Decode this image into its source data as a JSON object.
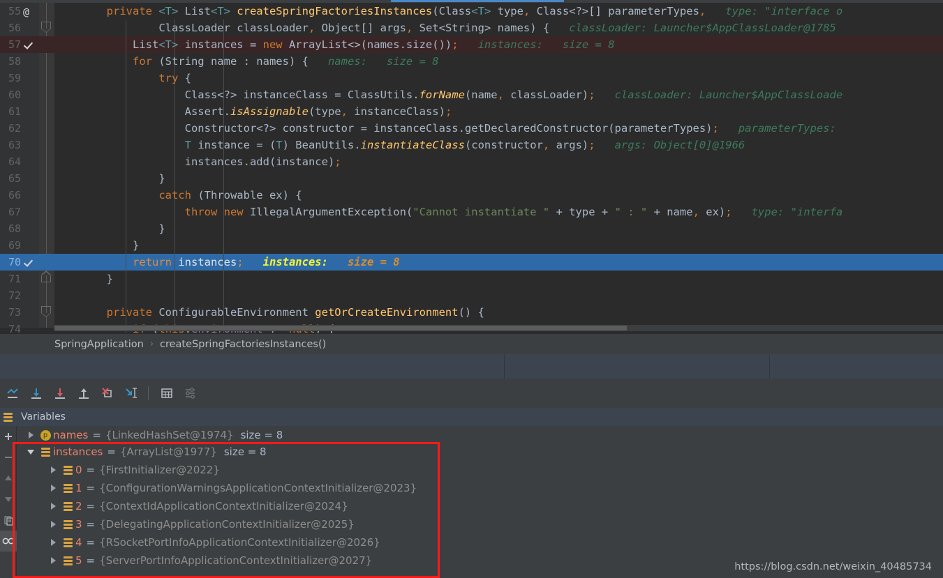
{
  "editor": {
    "active_tab_accent": "#4a88c7",
    "lines": [
      {
        "num": "55",
        "gutter": "annotation",
        "fold": "none",
        "highlight": "none",
        "segments": [
          {
            "t": "        ",
            "c": "id"
          },
          {
            "t": "private ",
            "c": "kw"
          },
          {
            "t": "<T> ",
            "c": "tp"
          },
          {
            "t": "List",
            "c": "id"
          },
          {
            "t": "<T> ",
            "c": "tp"
          },
          {
            "t": "createSpringFactoriesInstances",
            "c": "fn"
          },
          {
            "t": "(",
            "c": "punc"
          },
          {
            "t": "Class",
            "c": "id"
          },
          {
            "t": "<T> ",
            "c": "tp"
          },
          {
            "t": "type",
            "c": "id"
          },
          {
            "t": ", ",
            "c": "semi"
          },
          {
            "t": "Class<?>[] ",
            "c": "id"
          },
          {
            "t": "parameterTypes",
            "c": "id"
          },
          {
            "t": ",",
            "c": "semi"
          },
          {
            "t": "   type: \"interface o",
            "c": "hint"
          }
        ]
      },
      {
        "num": "56",
        "gutter": "none",
        "fold": "down",
        "highlight": "none",
        "segments": [
          {
            "t": "                ",
            "c": "id"
          },
          {
            "t": "ClassLoader classLoader",
            "c": "id"
          },
          {
            "t": ", ",
            "c": "semi"
          },
          {
            "t": "Object[] args",
            "c": "id"
          },
          {
            "t": ", ",
            "c": "semi"
          },
          {
            "t": "Set<String> names",
            "c": "id"
          },
          {
            "t": ") {",
            "c": "punc"
          },
          {
            "t": "   classLoader: Launcher$AppClassLoader@1785",
            "c": "hint"
          }
        ]
      },
      {
        "num": "57",
        "gutter": "breakpoint",
        "fold": "none",
        "highlight": "bp",
        "segments": [
          {
            "t": "            ",
            "c": "id"
          },
          {
            "t": "List",
            "c": "id"
          },
          {
            "t": "<T> ",
            "c": "tp"
          },
          {
            "t": "instances = ",
            "c": "id"
          },
          {
            "t": "new ",
            "c": "kw"
          },
          {
            "t": "ArrayList<>(names.size())",
            "c": "id"
          },
          {
            "t": ";",
            "c": "semi"
          },
          {
            "t": "   instances:   size = 8",
            "c": "hint"
          }
        ]
      },
      {
        "num": "58",
        "gutter": "none",
        "fold": "none",
        "highlight": "none",
        "segments": [
          {
            "t": "            ",
            "c": "id"
          },
          {
            "t": "for ",
            "c": "kw"
          },
          {
            "t": "(String name : names) {",
            "c": "id"
          },
          {
            "t": "   names:   size = 8",
            "c": "hint"
          }
        ]
      },
      {
        "num": "59",
        "gutter": "none",
        "fold": "none",
        "highlight": "none",
        "segments": [
          {
            "t": "                ",
            "c": "id"
          },
          {
            "t": "try ",
            "c": "kw"
          },
          {
            "t": "{",
            "c": "punc"
          }
        ]
      },
      {
        "num": "60",
        "gutter": "none",
        "fold": "none",
        "highlight": "none",
        "segments": [
          {
            "t": "                    ",
            "c": "id"
          },
          {
            "t": "Class<?> instanceClass = ClassUtils.",
            "c": "id"
          },
          {
            "t": "forName",
            "c": "fni"
          },
          {
            "t": "(name",
            "c": "id"
          },
          {
            "t": ", ",
            "c": "semi"
          },
          {
            "t": "classLoader)",
            "c": "id"
          },
          {
            "t": ";",
            "c": "semi"
          },
          {
            "t": "   classLoader: Launcher$AppClassLoade",
            "c": "hint"
          }
        ]
      },
      {
        "num": "61",
        "gutter": "none",
        "fold": "none",
        "highlight": "none",
        "segments": [
          {
            "t": "                    ",
            "c": "id"
          },
          {
            "t": "Assert.",
            "c": "id"
          },
          {
            "t": "isAssignable",
            "c": "fni"
          },
          {
            "t": "(type",
            "c": "id"
          },
          {
            "t": ", ",
            "c": "semi"
          },
          {
            "t": "instanceClass)",
            "c": "id"
          },
          {
            "t": ";",
            "c": "semi"
          }
        ]
      },
      {
        "num": "62",
        "gutter": "none",
        "fold": "none",
        "highlight": "none",
        "segments": [
          {
            "t": "                    ",
            "c": "id"
          },
          {
            "t": "Constructor<?> constructor = instanceClass.getDeclaredConstructor(parameterTypes)",
            "c": "id"
          },
          {
            "t": ";",
            "c": "semi"
          },
          {
            "t": "   parameterTypes:  ",
            "c": "hint"
          }
        ]
      },
      {
        "num": "63",
        "gutter": "none",
        "fold": "none",
        "highlight": "none",
        "segments": [
          {
            "t": "                    ",
            "c": "id"
          },
          {
            "t": "T ",
            "c": "tp"
          },
          {
            "t": "instance = (",
            "c": "id"
          },
          {
            "t": "T",
            "c": "tp"
          },
          {
            "t": ") BeanUtils.",
            "c": "id"
          },
          {
            "t": "instantiateClass",
            "c": "fni"
          },
          {
            "t": "(constructor",
            "c": "id"
          },
          {
            "t": ", ",
            "c": "semi"
          },
          {
            "t": "args)",
            "c": "id"
          },
          {
            "t": ";",
            "c": "semi"
          },
          {
            "t": "   args: Object[0]@1966",
            "c": "hint"
          }
        ]
      },
      {
        "num": "64",
        "gutter": "none",
        "fold": "none",
        "highlight": "none",
        "segments": [
          {
            "t": "                    ",
            "c": "id"
          },
          {
            "t": "instances.add(instance)",
            "c": "id"
          },
          {
            "t": ";",
            "c": "semi"
          }
        ]
      },
      {
        "num": "65",
        "gutter": "none",
        "fold": "none",
        "highlight": "none",
        "segments": [
          {
            "t": "                ",
            "c": "id"
          },
          {
            "t": "}",
            "c": "punc"
          }
        ]
      },
      {
        "num": "66",
        "gutter": "none",
        "fold": "none",
        "highlight": "none",
        "segments": [
          {
            "t": "                ",
            "c": "id"
          },
          {
            "t": "catch ",
            "c": "kw"
          },
          {
            "t": "(Throwable ex) {",
            "c": "id"
          }
        ]
      },
      {
        "num": "67",
        "gutter": "none",
        "fold": "none",
        "highlight": "none",
        "segments": [
          {
            "t": "                    ",
            "c": "id"
          },
          {
            "t": "throw new ",
            "c": "kw"
          },
          {
            "t": "IllegalArgumentException(",
            "c": "id"
          },
          {
            "t": "\"Cannot instantiate \"",
            "c": "str"
          },
          {
            "t": " + type + ",
            "c": "id"
          },
          {
            "t": "\" : \"",
            "c": "str"
          },
          {
            "t": " + name",
            "c": "id"
          },
          {
            "t": ", ",
            "c": "semi"
          },
          {
            "t": "ex)",
            "c": "id"
          },
          {
            "t": ";",
            "c": "semi"
          },
          {
            "t": "   type: \"interfa",
            "c": "hint"
          }
        ]
      },
      {
        "num": "68",
        "gutter": "none",
        "fold": "none",
        "highlight": "none",
        "segments": [
          {
            "t": "                ",
            "c": "id"
          },
          {
            "t": "}",
            "c": "punc"
          }
        ]
      },
      {
        "num": "69",
        "gutter": "none",
        "fold": "none",
        "highlight": "none",
        "segments": [
          {
            "t": "            ",
            "c": "id"
          },
          {
            "t": "}",
            "c": "punc"
          }
        ]
      },
      {
        "num": "70",
        "gutter": "breakpoint",
        "fold": "none",
        "highlight": "exec",
        "segments": [
          {
            "t": "            ",
            "c": "id"
          },
          {
            "t": "return ",
            "c": "kw"
          },
          {
            "t": "instances",
            "c": "id"
          },
          {
            "t": ";",
            "c": "semi"
          },
          {
            "t": "   instances:",
            "c": "hint-name"
          },
          {
            "t": "   size = 8",
            "c": "hint-val"
          }
        ]
      },
      {
        "num": "71",
        "gutter": "none",
        "fold": "up",
        "highlight": "none",
        "segments": [
          {
            "t": "        ",
            "c": "id"
          },
          {
            "t": "}",
            "c": "punc"
          }
        ]
      },
      {
        "num": "72",
        "gutter": "none",
        "fold": "none",
        "highlight": "none",
        "segments": []
      },
      {
        "num": "73",
        "gutter": "none",
        "fold": "down",
        "highlight": "none",
        "segments": [
          {
            "t": "        ",
            "c": "id"
          },
          {
            "t": "private ",
            "c": "kw"
          },
          {
            "t": "ConfigurableEnvironment ",
            "c": "id"
          },
          {
            "t": "getOrCreateEnvironment",
            "c": "fn"
          },
          {
            "t": "() {",
            "c": "punc"
          }
        ]
      },
      {
        "num": "74",
        "gutter": "none",
        "fold": "none",
        "highlight": "none",
        "segments": [
          {
            "t": "            ",
            "c": "id"
          },
          {
            "t": "if ",
            "c": "kw"
          },
          {
            "t": "(",
            "c": "punc"
          },
          {
            "t": "this",
            "c": "kw"
          },
          {
            "t": ".",
            "c": "punc"
          },
          {
            "t": "environment",
            "c": "fld"
          },
          {
            "t": " != ",
            "c": "id"
          },
          {
            "t": "null",
            "c": "kw"
          },
          {
            "t": ") {",
            "c": "punc"
          }
        ]
      }
    ]
  },
  "breadcrumb": {
    "items": [
      "SpringApplication",
      "createSpringFactoriesInstances()"
    ],
    "separator": "›"
  },
  "debug_toolbar": {
    "buttons": [
      {
        "name": "show-execution-point-icon",
        "title": "Show Execution Point"
      },
      {
        "name": "step-over-icon",
        "title": "Step Over"
      },
      {
        "name": "step-into-icon",
        "title": "Step Into"
      },
      {
        "name": "step-out-icon",
        "title": "Step Out"
      },
      {
        "name": "force-step-into-icon",
        "title": "Force Step Into"
      },
      {
        "name": "run-to-cursor-icon",
        "title": "Run to Cursor"
      },
      {
        "name": "evaluate-expression-icon",
        "title": "Evaluate Expression"
      },
      {
        "name": "settings-icon",
        "title": "Settings"
      }
    ]
  },
  "variables_panel": {
    "title": "Variables",
    "sidebar_buttons": [
      {
        "name": "add-watch-button",
        "glyph": "+"
      },
      {
        "name": "remove-watch-button",
        "glyph": "−"
      },
      {
        "name": "move-up-button",
        "glyph": "▲"
      },
      {
        "name": "move-down-button",
        "glyph": "▼"
      },
      {
        "name": "copy-value-button",
        "glyph": "copy"
      },
      {
        "name": "watches-toggle-button",
        "glyph": "watches"
      }
    ],
    "rows": [
      {
        "indent": 0,
        "toggle": "collapsed",
        "icon": "param",
        "name": "names",
        "eq": "=",
        "value": "{LinkedHashSet@1974}",
        "size": "size = 8",
        "clipped": true
      },
      {
        "indent": 0,
        "toggle": "expanded",
        "icon": "list",
        "name": "instances",
        "eq": "=",
        "value": "{ArrayList@1977}",
        "size": "size = 8"
      },
      {
        "indent": 1,
        "toggle": "collapsed",
        "icon": "list",
        "name": "0",
        "eq": "=",
        "value": "{FirstInitializer@2022}",
        "size": ""
      },
      {
        "indent": 1,
        "toggle": "collapsed",
        "icon": "list",
        "name": "1",
        "eq": "=",
        "value": "{ConfigurationWarningsApplicationContextInitializer@2023}",
        "size": ""
      },
      {
        "indent": 1,
        "toggle": "collapsed",
        "icon": "list",
        "name": "2",
        "eq": "=",
        "value": "{ContextIdApplicationContextInitializer@2024}",
        "size": ""
      },
      {
        "indent": 1,
        "toggle": "collapsed",
        "icon": "list",
        "name": "3",
        "eq": "=",
        "value": "{DelegatingApplicationContextInitializer@2025}",
        "size": ""
      },
      {
        "indent": 1,
        "toggle": "collapsed",
        "icon": "list",
        "name": "4",
        "eq": "=",
        "value": "{RSocketPortInfoApplicationContextInitializer@2026}",
        "size": ""
      },
      {
        "indent": 1,
        "toggle": "collapsed",
        "icon": "list",
        "name": "5",
        "eq": "=",
        "value": "{ServerPortInfoApplicationContextInitializer@2027}",
        "size": ""
      }
    ]
  },
  "annotation": {
    "highlight_color": "#ff1a1a"
  },
  "watermark": {
    "text": "https://blog.csdn.net/weixin_40485734"
  }
}
